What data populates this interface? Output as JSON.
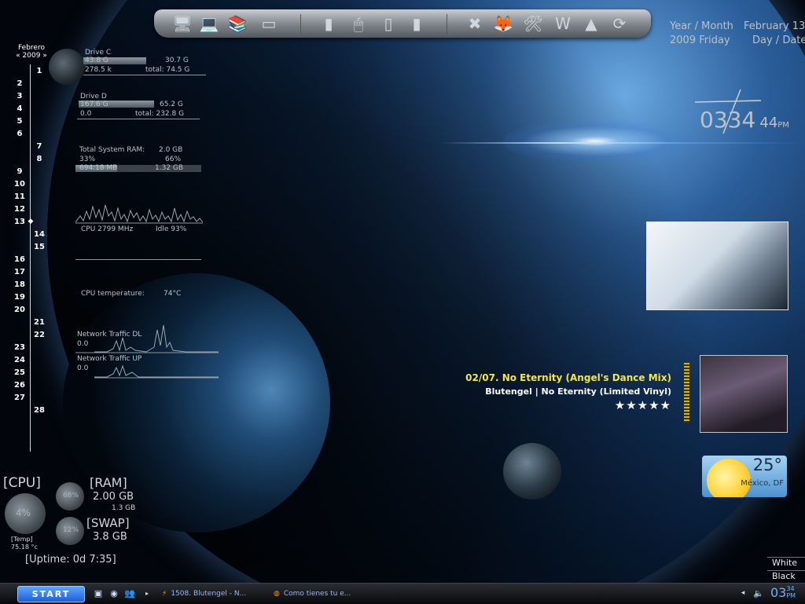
{
  "dock": {
    "icons": [
      "computer-icon",
      "network-computer-icon",
      "books-icon",
      "monitor-icon",
      "blade-computer-icon",
      "mouse-tower-icon",
      "pc-tower-icon",
      "blade-computer-2-icon",
      "x-app-icon",
      "firefox-icon",
      "tools-icon",
      "word-icon",
      "avast-icon",
      "update-icon"
    ]
  },
  "calendar": {
    "month": "Febrero",
    "year": "2009",
    "prev": "«",
    "next": "»",
    "days": [
      "1",
      "2",
      "3",
      "4",
      "5",
      "6",
      "7",
      "8",
      "9",
      "10",
      "11",
      "12",
      "13",
      "14",
      "15",
      "16",
      "17",
      "18",
      "19",
      "20",
      "21",
      "22",
      "23",
      "24",
      "25",
      "26",
      "27",
      "28"
    ],
    "today": "13",
    "today_marker": "◆"
  },
  "drive_c": {
    "label": "Drive C",
    "used": "43.8 G",
    "free": "30.7 G",
    "activity": "278.5 k",
    "total": "total: 74.5 G",
    "fill": 0.59
  },
  "drive_d": {
    "label": "Drive D",
    "used": "167.6 G",
    "free": "65.2 G",
    "activity": "0.0",
    "total": "total: 232.8 G",
    "fill": 0.72
  },
  "ram": {
    "label": "Total System RAM:",
    "total": "2.0 GB",
    "used_pct": "33%",
    "free_pct": "66%",
    "used": "694.18 MB",
    "free": "1.32 GB",
    "fill": 0.33
  },
  "cpu_meter": {
    "freq": "CPU 2799 MHz",
    "idle": "Idle 93%"
  },
  "cpu_temp": {
    "label": "CPU temperature:",
    "value": "74°C"
  },
  "network": {
    "dl_label": "Network Traffic DL",
    "dl_value": "0.0",
    "ul_label": "Network Traffic UP",
    "ul_value": "0.0"
  },
  "datetime": {
    "row1_left": "Year / Month",
    "row1_right": "February 13",
    "row2_left": "2009 Friday",
    "row2_right": "Day / Date",
    "hour": "03",
    "minute": "34",
    "second": "44",
    "ampm": "PM"
  },
  "player": {
    "title": "02/07. No Eternity (Angel's Dance Mix)",
    "artist_album": "Blutengel | No Eternity (Limited Vinyl)",
    "rating": "★★★★★",
    "rating_value": 5
  },
  "weather": {
    "temp": "25°",
    "city": "México, DF"
  },
  "stats": {
    "cpu_label": "[CPU]",
    "cpu_pct": "4%",
    "temp_label": "[Temp]",
    "temp_value": "75.18 °c",
    "ram_label": "[RAM]",
    "ram_value": "2.00 GB",
    "ram_sub": "1.3 GB",
    "ram_gauge": "68%",
    "swap_label": "[SWAP]",
    "swap_value": "3.8 GB",
    "swap_gauge": "12%",
    "uptime": "[Uptime: 0d 7:35]"
  },
  "theme": {
    "white": "White",
    "black": "Black"
  },
  "taskbar": {
    "start": "START",
    "task1": "1508. Blutengel - N...",
    "task2": "Como tienes tu e...",
    "tray_hour": "03",
    "tray_min": "34",
    "tray_ampm": "PM"
  },
  "colors": {
    "accent": "#6fb0ff",
    "song_title": "#f2e64a",
    "planet": "#2b5e9a"
  }
}
